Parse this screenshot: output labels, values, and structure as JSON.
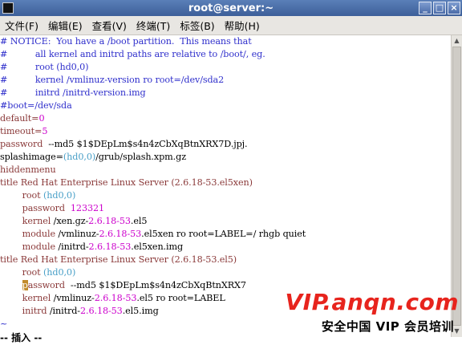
{
  "window": {
    "title": "root@server:~",
    "controls": [
      "_",
      "□",
      "×"
    ]
  },
  "menu": [
    {
      "label": "文件(F)"
    },
    {
      "label": "编辑(E)"
    },
    {
      "label": "查看(V)"
    },
    {
      "label": "终端(T)"
    },
    {
      "label": "标签(B)"
    },
    {
      "label": "帮助(H)"
    }
  ],
  "colors": {
    "comment": "#3030cc",
    "keyword": "#8b3a3a",
    "value": "#cc00cc",
    "hd": "#4aa0c8",
    "default": "#000000"
  },
  "editor": {
    "lines": [
      [
        {
          "t": "# NOTICE:  You have a /boot partition.  This means that",
          "c": "comment"
        }
      ],
      [
        {
          "t": "#          all kernel and initrd paths are relative to /boot/, eg.",
          "c": "comment"
        }
      ],
      [
        {
          "t": "#          root (hd0,0)",
          "c": "comment"
        }
      ],
      [
        {
          "t": "#          kernel /vmlinuz-version ro root=/dev/sda2",
          "c": "comment"
        }
      ],
      [
        {
          "t": "#          initrd /initrd-version.img",
          "c": "comment"
        }
      ],
      [
        {
          "t": "#boot=/dev/sda",
          "c": "comment"
        }
      ],
      [
        {
          "t": "default=",
          "c": "keyword"
        },
        {
          "t": "0",
          "c": "value"
        }
      ],
      [
        {
          "t": "timeout=",
          "c": "keyword"
        },
        {
          "t": "5",
          "c": "value"
        }
      ],
      [
        {
          "t": "password",
          "c": "keyword"
        },
        {
          "t": "  --md5 $1$DEpLm$s4n4zCbXqBtnXRX7D.jpj.",
          "c": "default"
        }
      ],
      [
        {
          "t": "splashimage=",
          "c": "default"
        },
        {
          "t": "(hd0,0)",
          "c": "hd"
        },
        {
          "t": "/grub/splash.xpm.gz",
          "c": "default"
        }
      ],
      [
        {
          "t": "hiddenmenu",
          "c": "keyword"
        }
      ],
      [
        {
          "t": "title Red Hat Enterprise Linux Server (2.6.18-53.el5xen)",
          "c": "keyword"
        }
      ],
      [
        {
          "t": "        root ",
          "c": "keyword"
        },
        {
          "t": "(hd0,0)",
          "c": "hd"
        }
      ],
      [
        {
          "t": "        password  ",
          "c": "keyword"
        },
        {
          "t": "123321",
          "c": "value"
        }
      ],
      [
        {
          "t": "        kernel ",
          "c": "keyword"
        },
        {
          "t": "/xen.gz-",
          "c": "default"
        },
        {
          "t": "2.6.18-53",
          "c": "value"
        },
        {
          "t": ".el5",
          "c": "default"
        }
      ],
      [
        {
          "t": "        module ",
          "c": "keyword"
        },
        {
          "t": "/vmlinuz-",
          "c": "default"
        },
        {
          "t": "2.6.18-53",
          "c": "value"
        },
        {
          "t": ".el5xen ro root=LABEL=/ rhgb quiet",
          "c": "default"
        }
      ],
      [
        {
          "t": "        module ",
          "c": "keyword"
        },
        {
          "t": "/initrd-",
          "c": "default"
        },
        {
          "t": "2.6.18-53",
          "c": "value"
        },
        {
          "t": ".el5xen.img",
          "c": "default"
        }
      ],
      [
        {
          "t": "title Red Hat Enterprise Linux Server (2.6.18-53.el5)",
          "c": "keyword"
        }
      ],
      [
        {
          "t": "        root ",
          "c": "keyword"
        },
        {
          "t": "(hd0,0)",
          "c": "hd"
        }
      ],
      [
        {
          "t": "        ",
          "c": "default"
        },
        {
          "t": "p",
          "c": "cursor"
        },
        {
          "t": "assword",
          "c": "keyword"
        },
        {
          "t": "  --md5 $1$DEpLm$s4n4zCbXqBtnXRX7",
          "c": "default"
        }
      ],
      [
        {
          "t": "        kernel ",
          "c": "keyword"
        },
        {
          "t": "/vmlinuz-",
          "c": "default"
        },
        {
          "t": "2.6.18-53",
          "c": "value"
        },
        {
          "t": ".el5 ro root=LABEL",
          "c": "default"
        }
      ],
      [
        {
          "t": "        initrd ",
          "c": "keyword"
        },
        {
          "t": "/initrd-",
          "c": "default"
        },
        {
          "t": "2.6.18-53",
          "c": "value"
        },
        {
          "t": ".el5.img",
          "c": "default"
        }
      ],
      [
        {
          "t": "~",
          "c": "comment"
        }
      ]
    ]
  },
  "status": {
    "mode": "-- 插入 --"
  },
  "watermark": {
    "line1": "VIP.anqn.com",
    "line2": "安全中国 VIP 会员培训"
  }
}
